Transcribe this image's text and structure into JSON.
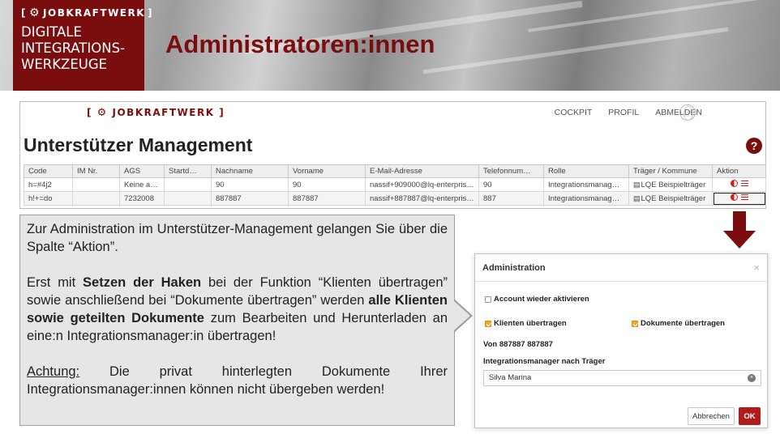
{
  "slide": {
    "brand_logo": "JOBKRAFTWERK",
    "brand_subtitle_lines": [
      "DIGITALE",
      "INTEGRATIONS-",
      "WERKZEUGE"
    ],
    "title": "Administratoren:innen"
  },
  "app": {
    "logo": "JOBKRAFTWERK",
    "nav": [
      "COCKPIT",
      "PROFIL",
      "ABMELDEN"
    ],
    "heading": "Unterstützer Management",
    "help": "?",
    "table": {
      "columns": [
        "Code",
        "IM Nr.",
        "AGS",
        "Startd…",
        "Nachname",
        "Vorname",
        "E-Mail-Adresse",
        "Telefonnum…",
        "Rolle",
        "Träger / Kommune",
        "Aktion"
      ],
      "rows": [
        [
          "h=#4j2",
          "",
          "Keine angeg",
          "",
          "90",
          "90",
          "nassif+909000@lq-enterpris…",
          "90",
          "Integrationsmanag…",
          "LQE Beispielträger",
          ""
        ],
        [
          "h!+=do",
          "",
          "7232008",
          "",
          "887887",
          "887887",
          "nassif+887887@lq-enterpris…",
          "887",
          "Integrationsmanag…",
          "LQE Beispielträger",
          ""
        ]
      ]
    }
  },
  "callout": {
    "p1": "Zur Administration im Unterstützer-Management gelangen Sie über die Spalte “Aktion”.",
    "p2_a": "Erst mit ",
    "p2_b": "Setzen der Haken",
    "p2_c": " bei der Funktion “Klienten übertragen” sowie anschließend bei “Dokumente übertragen” werden ",
    "p2_d": "alle Klienten sowie geteilten Dokumente",
    "p2_e": " zum Bearbeiten und Herunterladen an eine:n Integrationsmanager:in übertragen!",
    "p3_a": "Achtung:",
    "p3_b": " Die privat hinterlegten Dokumente Ihrer Integrationsmanager:innen können nicht übergeben werden!"
  },
  "modal": {
    "title": "Administration",
    "close": "×",
    "account_label": "Account wieder aktivieren",
    "clients_label": "Klienten übertragen",
    "docs_label": "Dokumente übertragen",
    "from": "Von 887887 887887",
    "im_label": "Integrationsmanager nach Träger",
    "im_value": "Silva Marina",
    "clear": "×",
    "cancel": "Abbrechen",
    "ok": "OK"
  },
  "colors": {
    "brand": "#7a0e0e",
    "ok_button": "#b31b1b",
    "checkbox": "#f0a825"
  }
}
